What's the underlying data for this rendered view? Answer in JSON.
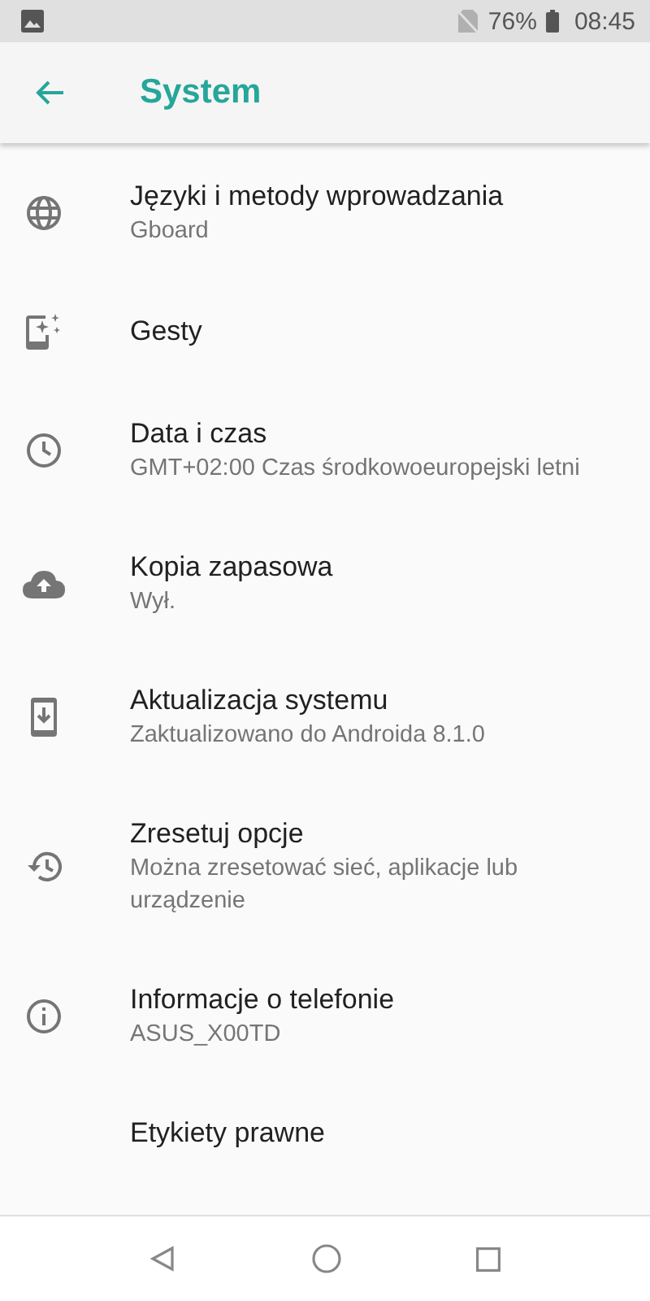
{
  "status_bar": {
    "battery": "76%",
    "time": "08:45"
  },
  "toolbar": {
    "title": "System"
  },
  "items": [
    {
      "kind": "globe",
      "title": "Języki i metody wprowadzania",
      "subtitle": "Gboard"
    },
    {
      "kind": "gestures",
      "title": "Gesty"
    },
    {
      "kind": "clock",
      "title": "Data i czas",
      "subtitle": "GMT+02:00 Czas środkowoeuropejski letni"
    },
    {
      "kind": "cloud",
      "title": "Kopia zapasowa",
      "subtitle": "Wył."
    },
    {
      "kind": "update",
      "title": "Aktualizacja systemu",
      "subtitle": "Zaktualizowano do Androida 8.1.0"
    },
    {
      "kind": "restore",
      "title": "Zresetuj opcje",
      "subtitle": "Można zresetować sieć, aplikacje lub urządzenie"
    },
    {
      "kind": "info",
      "title": "Informacje o telefonie",
      "subtitle": "ASUS_X00TD"
    },
    {
      "kind": "plain",
      "title": "Etykiety prawne"
    }
  ]
}
